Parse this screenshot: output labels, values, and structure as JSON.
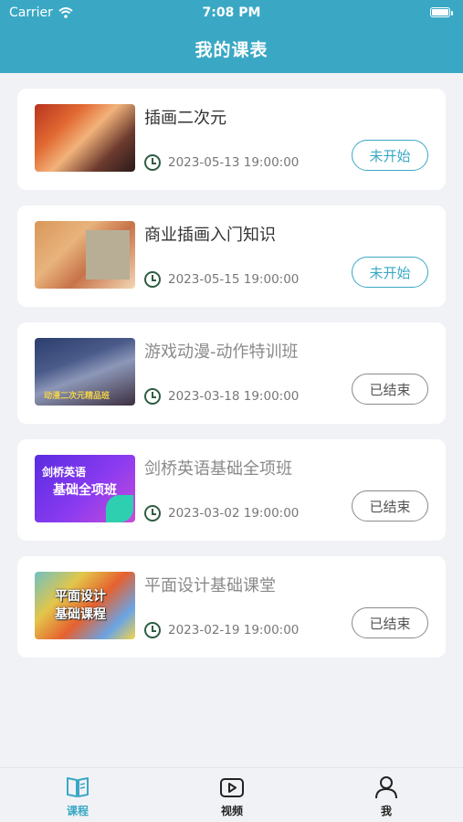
{
  "status_bar": {
    "carrier": "Carrier",
    "time": "7:08 PM"
  },
  "header": {
    "title": "我的课表"
  },
  "courses": [
    {
      "title": "插画二次元",
      "datetime": "2023-05-13 19:00:00",
      "status": "未开始",
      "state": "upcoming"
    },
    {
      "title": "商业插画入门知识",
      "datetime": "2023-05-15 19:00:00",
      "status": "未开始",
      "state": "upcoming"
    },
    {
      "title": "游戏动漫-动作特训班",
      "datetime": "2023-03-18 19:00:00",
      "status": "已结束",
      "state": "ended"
    },
    {
      "title": "剑桥英语基础全项班",
      "datetime": "2023-03-02 19:00:00",
      "status": "已结束",
      "state": "ended"
    },
    {
      "title": "平面设计基础课堂",
      "datetime": "2023-02-19 19:00:00",
      "status": "已结束",
      "state": "ended"
    }
  ],
  "thumb_text": {
    "course3": "动漫二次元精品班",
    "course4_line1": "剑桥英语",
    "course4_line2": "基础全项班",
    "course5_line1": "平面设计",
    "course5_line2": "基础课程"
  },
  "tabs": [
    {
      "label": "课程",
      "icon": "book-icon",
      "active": true
    },
    {
      "label": "视频",
      "icon": "video-play-icon",
      "active": false
    },
    {
      "label": "我",
      "icon": "user-icon",
      "active": false
    }
  ],
  "colors": {
    "accent": "#3aa8c4",
    "ended": "#8a8a8a",
    "background": "#f1f2f6"
  }
}
